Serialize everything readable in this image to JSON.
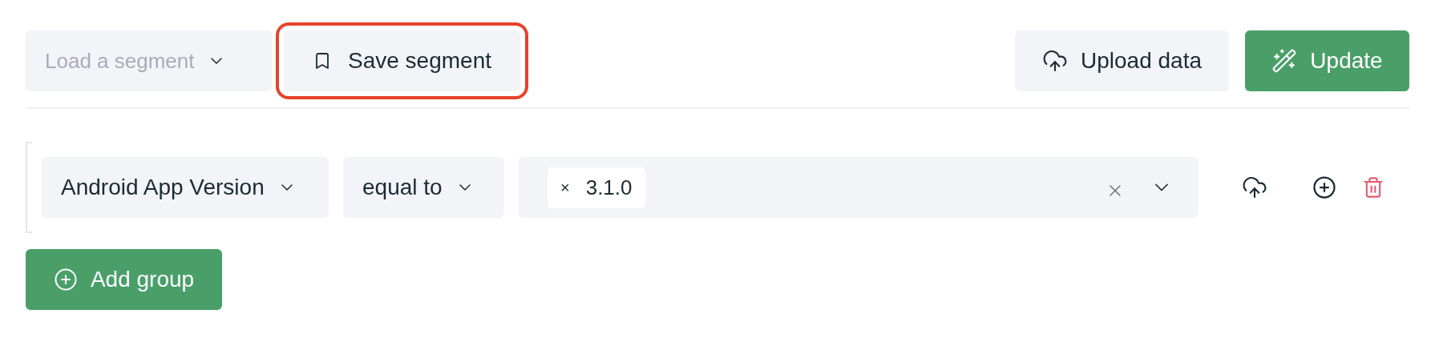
{
  "toolbar": {
    "load_segment": {
      "placeholder": "Load a segment"
    },
    "save_segment": {
      "label": "Save segment",
      "highlighted": true
    },
    "upload": {
      "label": "Upload data"
    },
    "update": {
      "label": "Update"
    }
  },
  "conditions": [
    {
      "field": "Android App Version",
      "operator": "equal to",
      "values": [
        {
          "remove": "×",
          "label": "3.1.0"
        }
      ]
    }
  ],
  "add_group": {
    "label": "Add group"
  }
}
